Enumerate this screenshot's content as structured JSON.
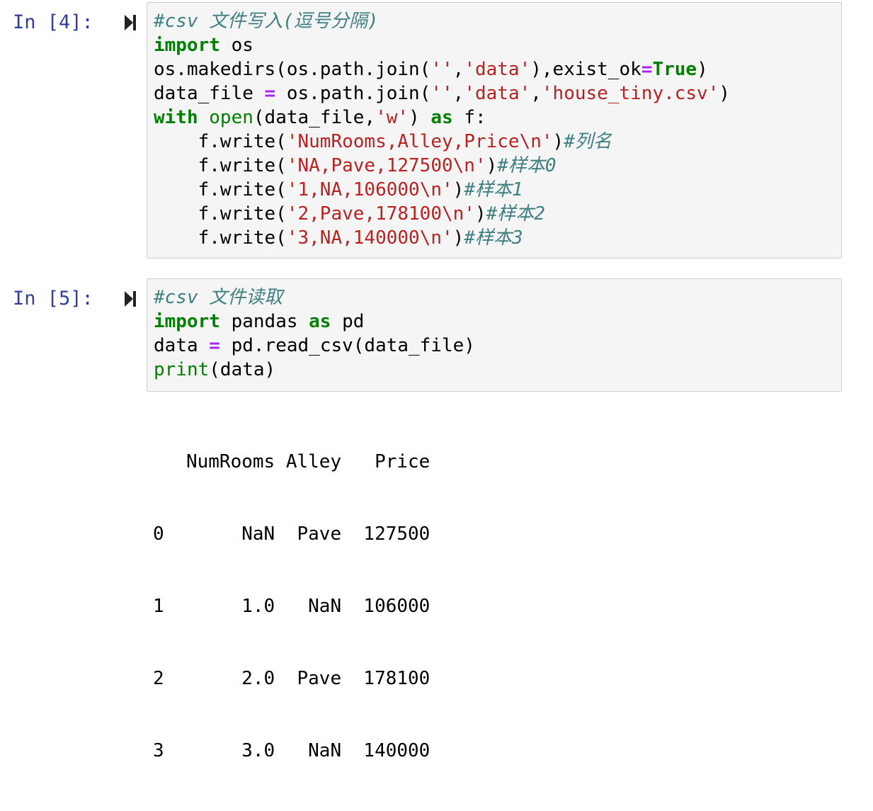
{
  "cells": [
    {
      "prompt": "In [4]:",
      "lines": [
        [
          {
            "t": "cm",
            "v": "#csv 文件写入(逗号分隔)"
          }
        ],
        [
          {
            "t": "kw",
            "v": "import"
          },
          {
            "t": "n",
            "v": " os"
          }
        ],
        [
          {
            "t": "n",
            "v": "os.makedirs(os.path.join("
          },
          {
            "t": "st",
            "v": "''"
          },
          {
            "t": "n",
            "v": ","
          },
          {
            "t": "st",
            "v": "'data'"
          },
          {
            "t": "n",
            "v": "),exist_ok"
          },
          {
            "t": "op",
            "v": "="
          },
          {
            "t": "kw",
            "v": "True"
          },
          {
            "t": "n",
            "v": ")"
          }
        ],
        [
          {
            "t": "n",
            "v": "data_file "
          },
          {
            "t": "op",
            "v": "="
          },
          {
            "t": "n",
            "v": " os.path.join("
          },
          {
            "t": "st",
            "v": "''"
          },
          {
            "t": "n",
            "v": ","
          },
          {
            "t": "st",
            "v": "'data'"
          },
          {
            "t": "n",
            "v": ","
          },
          {
            "t": "st",
            "v": "'house_tiny.csv'"
          },
          {
            "t": "n",
            "v": ")"
          }
        ],
        [
          {
            "t": "kw",
            "v": "with"
          },
          {
            "t": "n",
            "v": " "
          },
          {
            "t": "bi",
            "v": "open"
          },
          {
            "t": "n",
            "v": "(data_file,"
          },
          {
            "t": "st",
            "v": "'w'"
          },
          {
            "t": "n",
            "v": ") "
          },
          {
            "t": "kw",
            "v": "as"
          },
          {
            "t": "n",
            "v": " f:"
          }
        ],
        [
          {
            "t": "n",
            "v": "    f.write("
          },
          {
            "t": "st",
            "v": "'NumRooms,Alley,Price\\n'"
          },
          {
            "t": "n",
            "v": ")"
          },
          {
            "t": "cm",
            "v": "#列名"
          }
        ],
        [
          {
            "t": "n",
            "v": "    f.write("
          },
          {
            "t": "st",
            "v": "'NA,Pave,127500\\n'"
          },
          {
            "t": "n",
            "v": ")"
          },
          {
            "t": "cm",
            "v": "#样本0"
          }
        ],
        [
          {
            "t": "n",
            "v": "    f.write("
          },
          {
            "t": "st",
            "v": "'1,NA,106000\\n'"
          },
          {
            "t": "n",
            "v": ")"
          },
          {
            "t": "cm",
            "v": "#样本1"
          }
        ],
        [
          {
            "t": "n",
            "v": "    f.write("
          },
          {
            "t": "st",
            "v": "'2,Pave,178100\\n'"
          },
          {
            "t": "n",
            "v": ")"
          },
          {
            "t": "cm",
            "v": "#样本2"
          }
        ],
        [
          {
            "t": "n",
            "v": "    f.write("
          },
          {
            "t": "st",
            "v": "'3,NA,140000\\n'"
          },
          {
            "t": "n",
            "v": ")"
          },
          {
            "t": "cm",
            "v": "#样本3"
          }
        ]
      ]
    },
    {
      "prompt": "In [5]:",
      "lines": [
        [
          {
            "t": "cm",
            "v": "#csv 文件读取"
          }
        ],
        [
          {
            "t": "kw",
            "v": "import"
          },
          {
            "t": "n",
            "v": " pandas "
          },
          {
            "t": "kw",
            "v": "as"
          },
          {
            "t": "n",
            "v": " pd"
          }
        ],
        [
          {
            "t": "n",
            "v": "data "
          },
          {
            "t": "op",
            "v": "="
          },
          {
            "t": "n",
            "v": " pd.read_csv(data_file)"
          }
        ],
        [
          {
            "t": "bi",
            "v": "print"
          },
          {
            "t": "n",
            "v": "(data)"
          }
        ]
      ],
      "output": [
        "   NumRooms Alley   Price",
        "0       NaN  Pave  127500",
        "1       1.0   NaN  106000",
        "2       2.0  Pave  178100",
        "3       3.0   NaN  140000"
      ]
    }
  ],
  "icons": {
    "run": "run-cell-icon"
  },
  "colors": {
    "prompt": "#303f9f",
    "keyword": "#008000",
    "string": "#ba2121",
    "comment": "#408080",
    "operator": "#aa22ff",
    "code_bg": "#f5f5f5"
  }
}
